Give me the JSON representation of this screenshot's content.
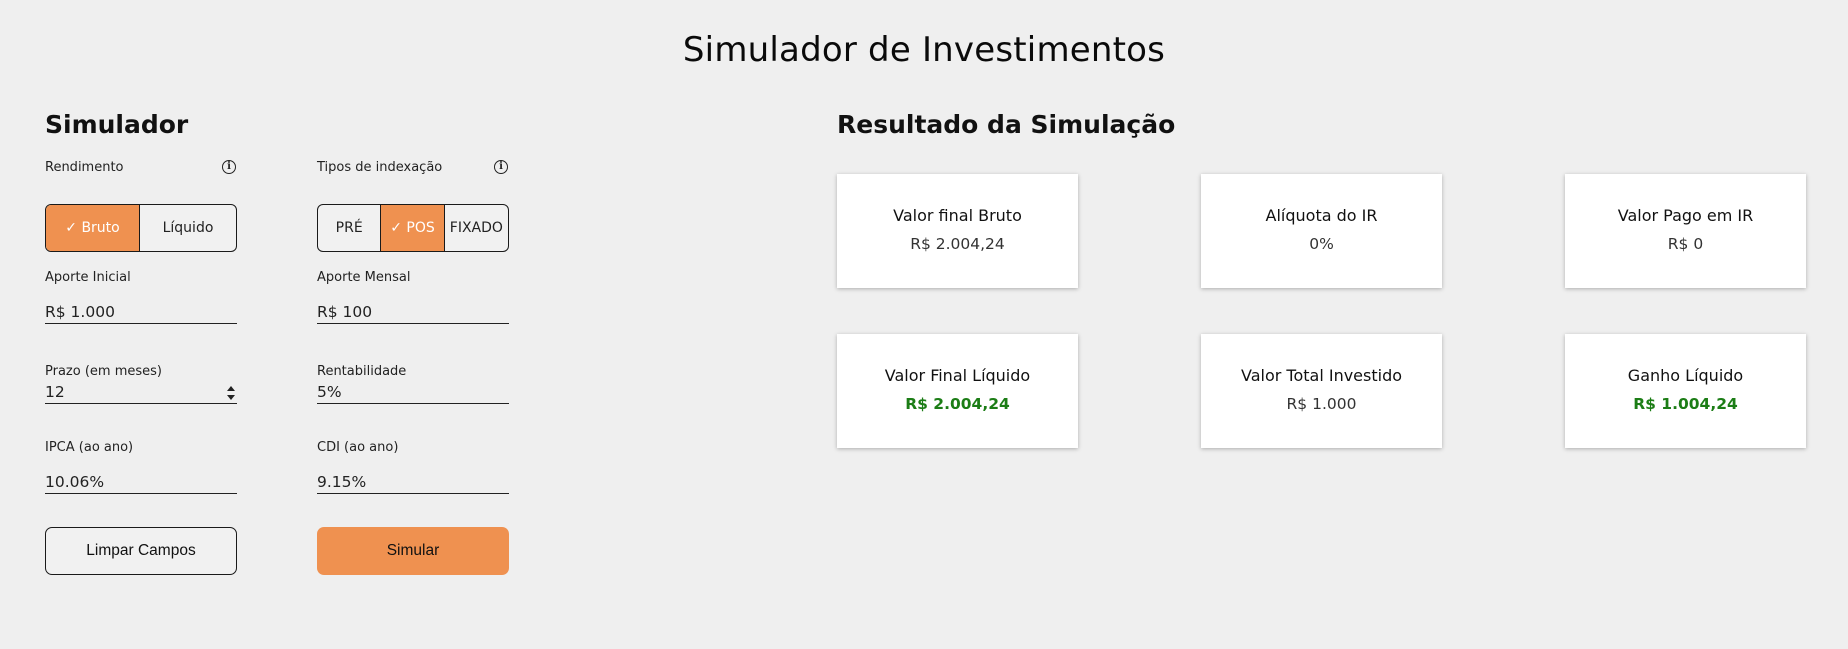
{
  "page_title": "Simulador de Investimentos",
  "simulator": {
    "title": "Simulador",
    "rendimento": {
      "label": "Rendimento",
      "options": [
        "✓ Bruto",
        "Líquido"
      ],
      "selected": "Bruto"
    },
    "indexacao": {
      "label": "Tipos de indexação",
      "options": [
        "PRÉ",
        "✓ POS",
        "FIXADO"
      ],
      "selected": "POS"
    },
    "aporte_inicial": {
      "label": "Aporte Inicial",
      "value": "R$ 1.000"
    },
    "aporte_mensal": {
      "label": "Aporte Mensal",
      "value": "R$ 100"
    },
    "prazo": {
      "label": "Prazo (em meses)",
      "value": "12"
    },
    "rentabilidade": {
      "label": "Rentabilidade",
      "value": "5%"
    },
    "ipca": {
      "label": "IPCA (ao ano)",
      "value": "10.06%"
    },
    "cdi": {
      "label": "CDI (ao ano)",
      "value": "9.15%"
    },
    "clear_button": "Limpar Campos",
    "simulate_button": "Simular"
  },
  "results": {
    "title": "Resultado da Simulação",
    "cards": [
      {
        "label": "Valor final Bruto",
        "value": "R$ 2.004,24"
      },
      {
        "label": "Alíquota do IR",
        "value": "0%"
      },
      {
        "label": "Valor Pago em IR",
        "value": "R$ 0"
      },
      {
        "label": "Valor Final Líquido",
        "value": "R$ 2.004,24"
      },
      {
        "label": "Valor Total Investido",
        "value": "R$ 1.000"
      },
      {
        "label": "Ganho Líquido",
        "value": "R$ 1.004,24"
      }
    ]
  },
  "colors": {
    "accent": "#ef9150",
    "positive": "#1c7d16",
    "background": "#efefef"
  },
  "icons": {
    "info": "info-circle-icon",
    "stepper": "number-stepper-icon"
  }
}
